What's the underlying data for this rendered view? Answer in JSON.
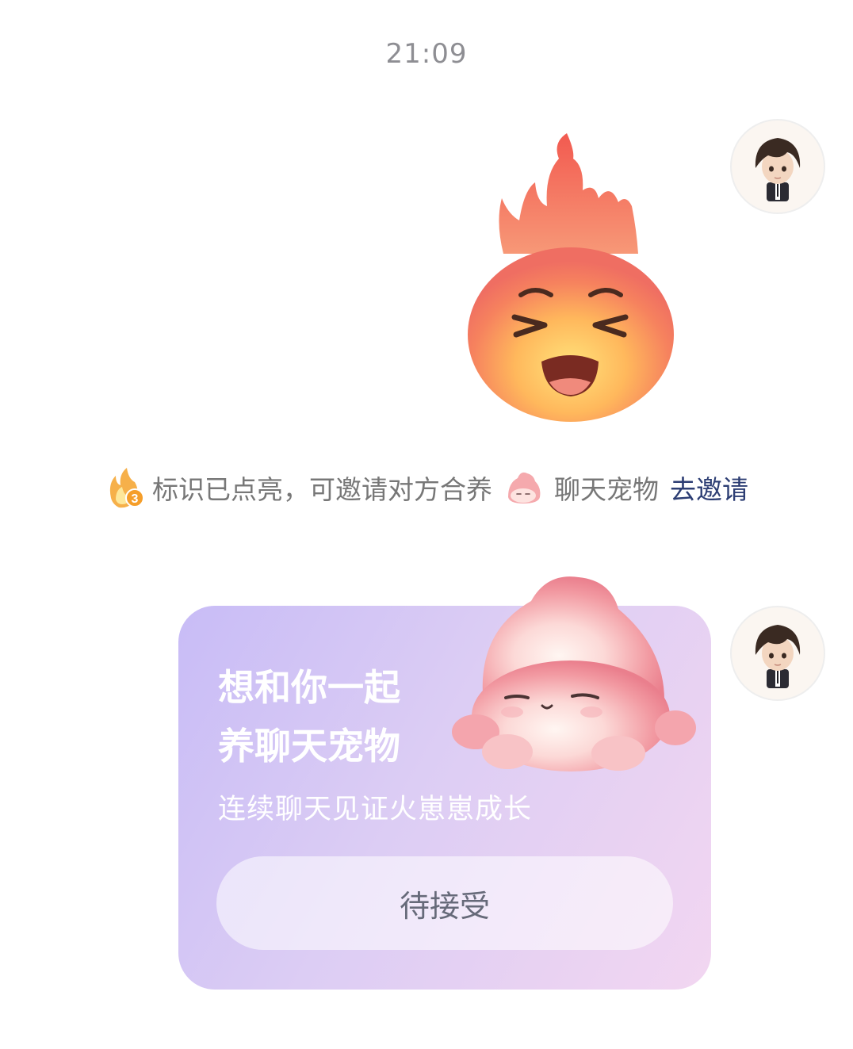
{
  "chat": {
    "timestamp": "21:09",
    "system_notice": {
      "badge_number": "3",
      "text_part1": "标识已点亮，可邀请对方合养",
      "text_part2": "聊天宠物",
      "invite_link": "去邀请"
    },
    "pet_invite_card": {
      "title_line1": "想和你一起",
      "title_line2": "养聊天宠物",
      "subtitle": "连续聊天见证火崽崽成长",
      "status_button": "待接受"
    }
  }
}
